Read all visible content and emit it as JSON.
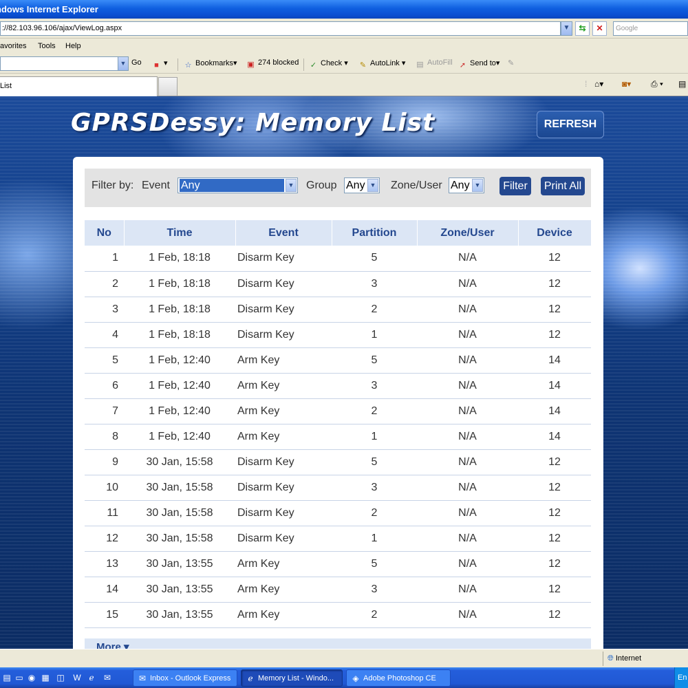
{
  "window": {
    "title": "ndows Internet Explorer"
  },
  "address": {
    "url": "://82.103.96.106/ajax/ViewLog.aspx",
    "search_placeholder": "Google"
  },
  "menu": {
    "favorites": "avorites",
    "tools": "Tools",
    "help": "Help"
  },
  "toolbar": {
    "go": "Go",
    "bookmarks": "Bookmarks",
    "blocked": "274 blocked",
    "check": "Check",
    "autolink": "AutoLink",
    "autofill": "AutoFill",
    "sendto": "Send to"
  },
  "tab": {
    "label": "List"
  },
  "page": {
    "title": "GPRSDessy: Memory List",
    "refresh": "REFRESH"
  },
  "filter": {
    "label": "Filter by:",
    "event_label": "Event",
    "event_value": "Any",
    "group_label": "Group",
    "group_value": "Any",
    "zone_label": "Zone/User",
    "zone_value": "Any",
    "filter_button": "Filter",
    "print_button": "Print All"
  },
  "table": {
    "headers": [
      "No",
      "Time",
      "Event",
      "Partition",
      "Zone/User",
      "Device"
    ],
    "rows": [
      [
        "1",
        "1 Feb, 18:18",
        "Disarm Key",
        "5",
        "N/A",
        "12"
      ],
      [
        "2",
        "1 Feb, 18:18",
        "Disarm Key",
        "3",
        "N/A",
        "12"
      ],
      [
        "3",
        "1 Feb, 18:18",
        "Disarm Key",
        "2",
        "N/A",
        "12"
      ],
      [
        "4",
        "1 Feb, 18:18",
        "Disarm Key",
        "1",
        "N/A",
        "12"
      ],
      [
        "5",
        "1 Feb, 12:40",
        "Arm Key",
        "5",
        "N/A",
        "14"
      ],
      [
        "6",
        "1 Feb, 12:40",
        "Arm Key",
        "3",
        "N/A",
        "14"
      ],
      [
        "7",
        "1 Feb, 12:40",
        "Arm Key",
        "2",
        "N/A",
        "14"
      ],
      [
        "8",
        "1 Feb, 12:40",
        "Arm Key",
        "1",
        "N/A",
        "14"
      ],
      [
        "9",
        "30 Jan, 15:58",
        "Disarm Key",
        "5",
        "N/A",
        "12"
      ],
      [
        "10",
        "30 Jan, 15:58",
        "Disarm Key",
        "3",
        "N/A",
        "12"
      ],
      [
        "11",
        "30 Jan, 15:58",
        "Disarm Key",
        "2",
        "N/A",
        "12"
      ],
      [
        "12",
        "30 Jan, 15:58",
        "Disarm Key",
        "1",
        "N/A",
        "12"
      ],
      [
        "13",
        "30 Jan, 13:55",
        "Arm Key",
        "5",
        "N/A",
        "12"
      ],
      [
        "14",
        "30 Jan, 13:55",
        "Arm Key",
        "3",
        "N/A",
        "12"
      ],
      [
        "15",
        "30 Jan, 13:55",
        "Arm Key",
        "2",
        "N/A",
        "12"
      ]
    ],
    "more": "More ▾"
  },
  "status": {
    "zone": "Internet"
  },
  "taskbar": {
    "tasks": [
      "Inbox - Outlook Express",
      "Memory List - Windo...",
      "Adobe Photoshop CE"
    ],
    "tray": "En"
  }
}
